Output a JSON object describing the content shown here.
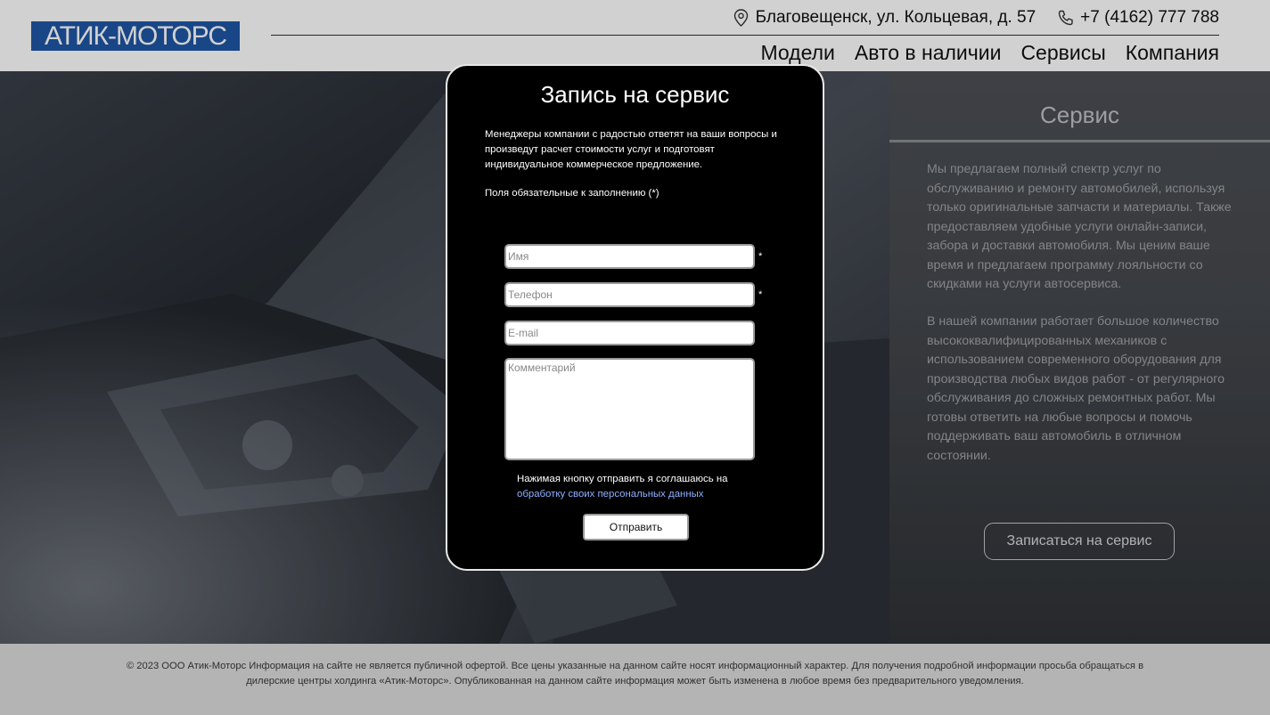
{
  "header": {
    "logo_text": "АТИК-МОТОРС",
    "address": "Благовещенск, ул. Кольцевая, д. 57",
    "phone": "+7 (4162) 777 788",
    "nav": [
      "Модели",
      "Авто в наличии",
      "Сервисы",
      "Компания"
    ]
  },
  "service": {
    "title": "Сервис",
    "paragraph1": "Мы предлагаем полный спектр услуг по обслуживанию и ремонту автомобилей, используя только оригинальные запчасти и материалы. Также предоставляем удобные услуги онлайн-записи, забора и доставки автомобиля. Мы ценим ваше время и предлагаем программу лояльности со скидками на услуги автосервиса.",
    "paragraph2": "В нашей компании работает большое количество высококвалифицированных механиков с использованием современного оборудования для производства любых видов работ - от регулярного обслуживания до сложных ремонтных работ. Мы готовы ответить на любые вопросы и помочь поддерживать ваш автомобиль в отличном состоянии.",
    "button": "Записаться на сервис"
  },
  "modal": {
    "title": "Запись на сервис",
    "description": "Менеджеры компании с радостью ответят на ваши вопросы и произведут расчет стоимости услуг и подготовят индивидуальное коммерческое предложение.",
    "required_note": "Поля обязательные к заполнению (*)",
    "name_placeholder": "Имя",
    "phone_placeholder": "Телефон",
    "email_placeholder": "E-mail",
    "comment_placeholder": "Комментарий",
    "required_mark": "*",
    "consent_text": "Нажимая кнопку отправить я соглашаюсь на",
    "consent_link": "обработку своих персональных данных",
    "submit": "Отправить"
  },
  "footer": {
    "text": "© 2023 ООО Атик-Моторс Информация на сайте не является публичной офертой. Все цены указанные на данном сайте носят информационный характер. Для получения подробной информации просьба обращаться в дилерские центры холдинга «Атик-Моторс». Опубликованная на данном сайте информация может быть изменена в любое время без предварительного уведомления."
  },
  "colors": {
    "logo_bg": "#1f56a4",
    "modal_bg": "#000000",
    "link": "#8fb0ff",
    "footer_bg": "#dcdcdc"
  }
}
